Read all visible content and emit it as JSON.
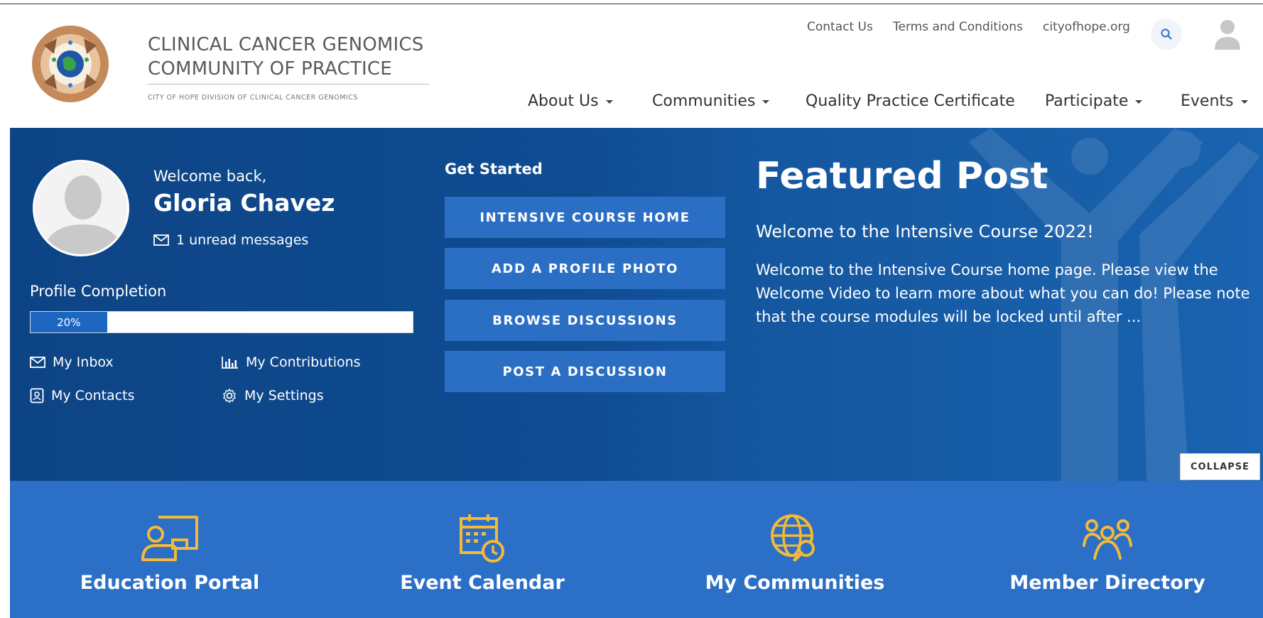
{
  "brand": {
    "title_line1": "CLINICAL CANCER GENOMICS",
    "title_line2": "COMMUNITY OF PRACTICE",
    "subtitle": "CITY OF HOPE DIVISION OF CLINICAL CANCER GENOMICS"
  },
  "utility_nav": {
    "contact": "Contact Us",
    "terms": "Terms and Conditions",
    "site": "cityofhope.org"
  },
  "main_nav": {
    "about": "About Us",
    "communities": "Communities",
    "certificate": "Quality Practice Certificate",
    "participate": "Participate",
    "events": "Events"
  },
  "profile": {
    "welcome_label": "Welcome back,",
    "name": "Gloria Chavez",
    "unread_messages": "1 unread messages",
    "completion_title": "Profile Completion",
    "completion_percent": 20,
    "completion_text": "20%"
  },
  "quick_links": {
    "inbox": "My Inbox",
    "contributions": "My Contributions",
    "contacts": "My Contacts",
    "settings": "My Settings"
  },
  "get_started": {
    "title": "Get Started",
    "buttons": [
      "INTENSIVE COURSE HOME",
      "ADD A PROFILE PHOTO",
      "BROWSE DISCUSSIONS",
      "POST A DISCUSSION"
    ]
  },
  "featured_post": {
    "title": "Featured Post",
    "subtitle": "Welcome to the Intensive Course 2022!",
    "body": "Welcome to the Intensive Course home page. Please view the Welcome Video to learn more about what you can do! Please note that the course modules will be locked until after ..."
  },
  "collapse_label": "COLLAPSE",
  "shortcuts": [
    "Education Portal",
    "Event Calendar",
    "My Communities",
    "Member Directory"
  ],
  "colors": {
    "hero_blue": "#0f4c92",
    "button_blue": "#2a6fc4",
    "shortcut_blue": "#2b6fc6",
    "icon_gold": "#f3b93a"
  }
}
